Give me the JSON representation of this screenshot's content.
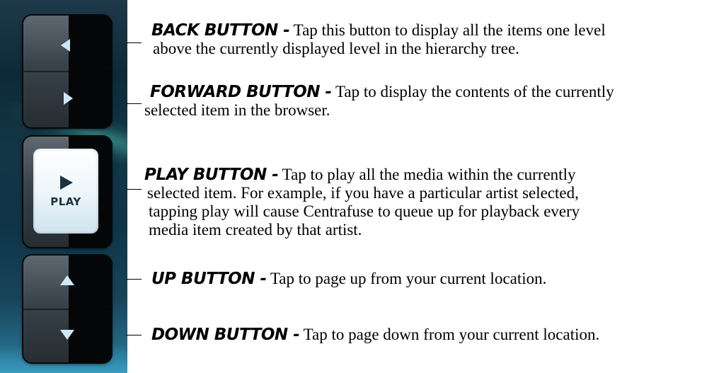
{
  "controls": {
    "play_label": "PLAY",
    "icons": [
      "back-arrow-icon",
      "forward-arrow-icon",
      "play-icon",
      "up-arrow-icon",
      "down-arrow-icon"
    ]
  },
  "descriptions": {
    "back": {
      "term": "BACK BUTTON -",
      "line1": " Tap this button to display all the items one level",
      "line2": "above the currently displayed level in the hierarchy tree."
    },
    "forward": {
      "term": "FORWARD BUTTON -",
      "line1": " Tap to display the contents of the currently",
      "line2": "selected item in the browser."
    },
    "play": {
      "term": "PLAY BUTTON -",
      "line1": " Tap to play all the media within the currently",
      "line2": "selected item. For example, if you have a particular artist selected,",
      "line3": "tapping play will cause Centrafuse to queue up for playback every",
      "line4": "media item created by that artist."
    },
    "up": {
      "term": "UP BUTTON -",
      "line1": " Tap to page up from your current location."
    },
    "down": {
      "term": "DOWN BUTTON -",
      "line1": " Tap to page down from your current location."
    }
  }
}
